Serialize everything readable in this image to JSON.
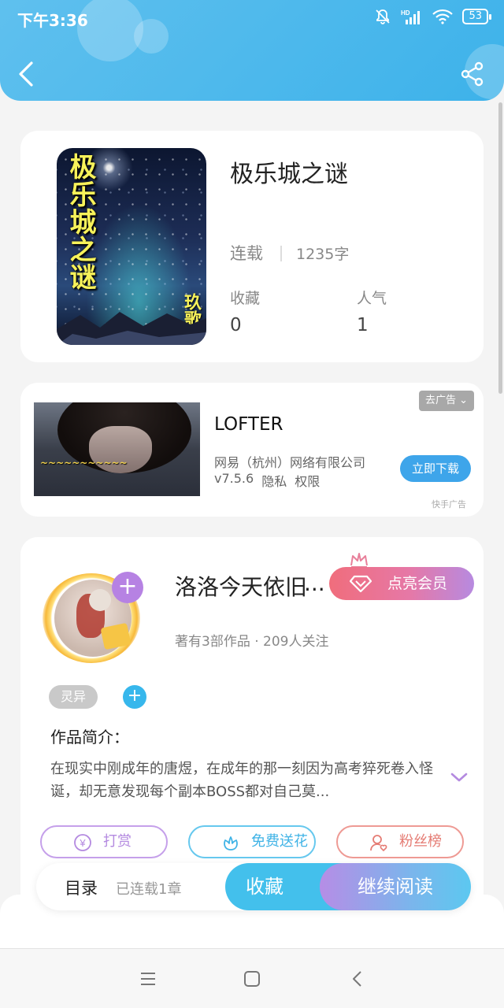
{
  "status_bar": {
    "time": "下午3:36",
    "battery": "53",
    "icons": [
      "bell-off-icon",
      "signal-icon",
      "wifi-icon",
      "battery-icon"
    ]
  },
  "header": {
    "background_color": "#3db2ea",
    "back_icon": "chevron-left-icon",
    "share_icon": "share-icon"
  },
  "book": {
    "cover_title": "极乐城之谜",
    "cover_author": "玖歌阿",
    "title": "极乐城之谜",
    "status": "连载",
    "word_count": "1235字",
    "stats": [
      {
        "label": "收藏",
        "value": "0"
      },
      {
        "label": "人气",
        "value": "1"
      }
    ]
  },
  "ad": {
    "close_label": "去广告",
    "app_name": "LOFTER",
    "company": "网易（杭州）网络有限公司",
    "version": "v7.5.6",
    "privacy": "隐私",
    "permissions": "权限",
    "download_label": "立即下载",
    "source": "快手广告",
    "button_color": "#3ea5ea"
  },
  "author": {
    "name": "洛洛今天依旧",
    "ellipsis": "...",
    "meta": "著有3部作品 · 209人关注",
    "vip_label": "点亮会员",
    "tag": "灵异",
    "intro_heading": "作品简介：",
    "intro_text": "在现实中刚成年的唐煜，在成年的那一刻因为高考猝死卷入怪诞，却无意发现每个副本BOSS都对自己莫...",
    "actions": [
      {
        "label": "打赏",
        "icon": "yuan-coin-icon",
        "color": "#b48ae0"
      },
      {
        "label": "免费送花",
        "icon": "flower-icon",
        "color": "#3fb3e6"
      },
      {
        "label": "粉丝榜",
        "icon": "fan-user-icon",
        "color": "#e57c74"
      }
    ]
  },
  "bottom_bar": {
    "catalog_label": "目录",
    "catalog_status": "已连载1章",
    "collect_label": "收藏",
    "read_label": "继续阅读"
  },
  "nav": {
    "icons": [
      "menu-icon",
      "home-square-icon",
      "back-triangle-icon"
    ]
  }
}
